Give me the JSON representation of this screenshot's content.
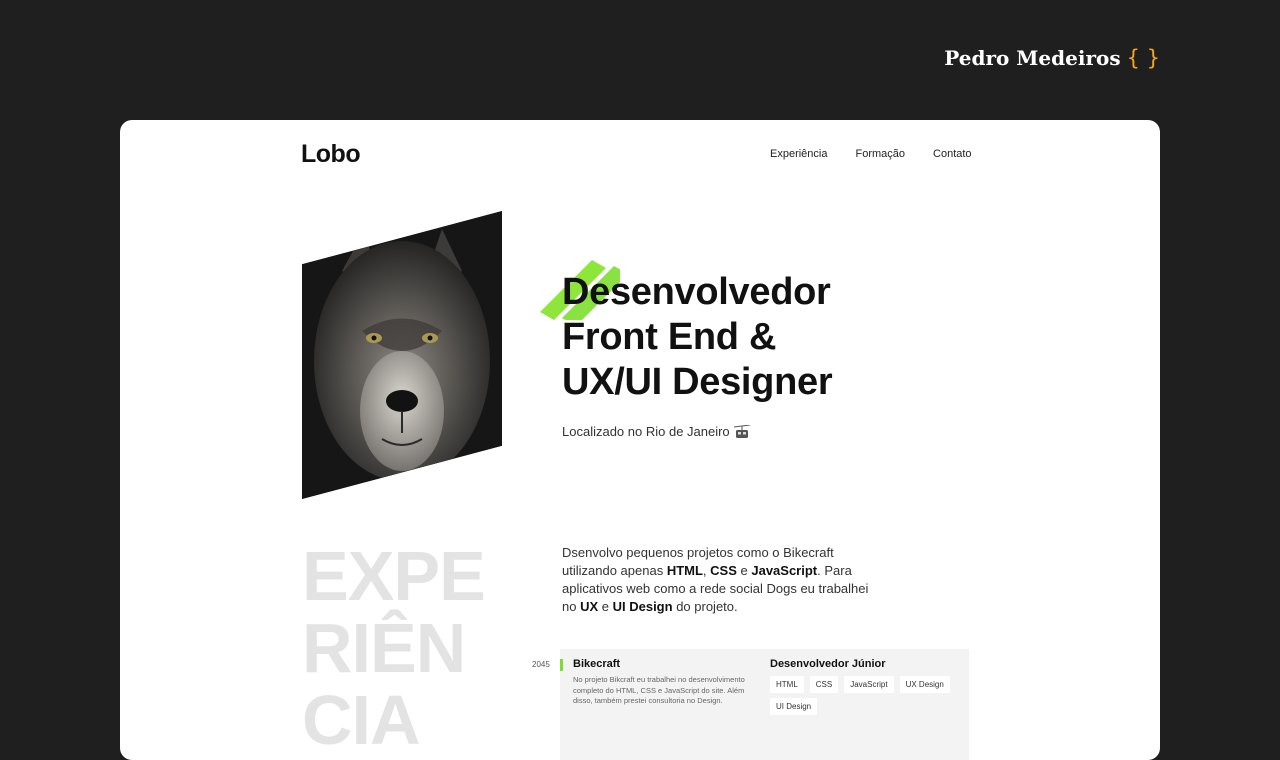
{
  "brand": {
    "name": "Pedro Medeiros",
    "icon": "curly-braces-icon",
    "accent": "#f2a61f"
  },
  "site": {
    "logo": "Lobo",
    "nav": [
      "Experiência",
      "Formação",
      "Contato"
    ],
    "hero": {
      "title_line1": "Desenvolvedor",
      "title_line2": "Front End &",
      "title_line3": "UX/UI Designer",
      "location": "Localizado no Rio de Janeiro",
      "location_icon": "cable-car-icon",
      "image": "wolf-portrait",
      "accent_color": "#7ddf2d"
    },
    "experience": {
      "bg_line1": "EXPE",
      "bg_line2": "RIÊN",
      "bg_line3": "CIA",
      "intro": {
        "p1": "Dsenvolvo pequenos projetos como o Bikecraft utilizando apenas ",
        "html": "HTML",
        "comma": ", ",
        "css": "CSS",
        "e1": " e ",
        "js": "JavaScript",
        "p2": ". Para aplicativos web como a rede social Dogs eu trabalhei no ",
        "ux": "UX",
        "e2": " e ",
        "ui": "UI Design",
        "p3": " do projeto."
      },
      "items": [
        {
          "year": "2045",
          "project": "Bikecraft",
          "description": "No projeto Bikcraft eu trabalhei no desenvolvimento completo do HTML, CSS e JavaScript do site. Além disso, também prestei consultoria no Design.",
          "role": "Desenvolvedor Júnior",
          "tags": [
            "HTML",
            "CSS",
            "JavaScript",
            "UX Design",
            "UI Design"
          ]
        }
      ]
    }
  }
}
